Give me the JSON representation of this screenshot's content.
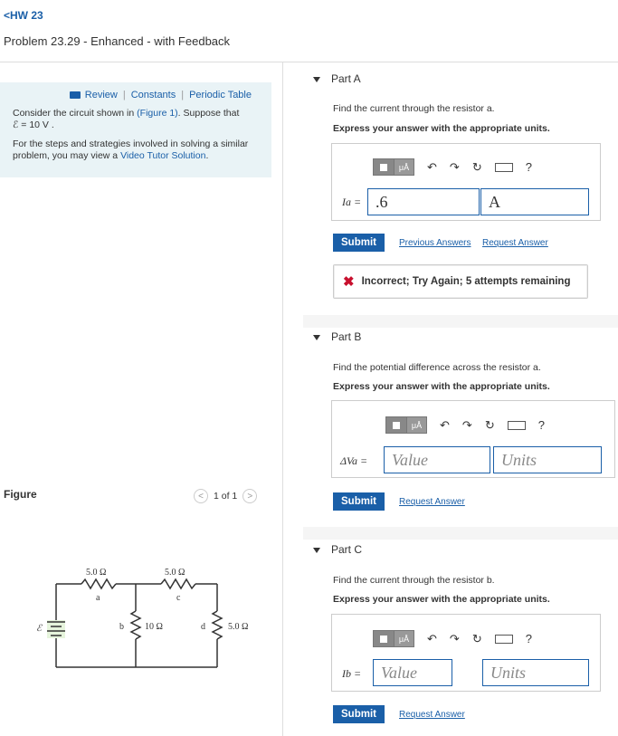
{
  "nav": {
    "back_label": "HW 23"
  },
  "problem": {
    "title": "Problem 23.29 - Enhanced - with Feedback"
  },
  "info": {
    "links": [
      "Review",
      "Constants",
      "Periodic Table"
    ],
    "text1_a": "Consider the circuit shown in ",
    "figure_link": "(Figure 1)",
    "text1_b": ". Suppose that",
    "emf_eq": "ℰ = 10  V .",
    "text2_a": "For the steps and strategies involved in solving a similar problem, you may view a ",
    "video_link": "Video Tutor Solution",
    "text2_b": "."
  },
  "figure": {
    "label": "Figure",
    "pager": "1 of 1"
  },
  "circuit": {
    "emf": "ℰ",
    "r_a": "5.0 Ω",
    "r_c": "5.0 Ω",
    "r_b": "10 Ω",
    "r_d": "5.0 Ω",
    "n_a": "a",
    "n_b": "b",
    "n_c": "c",
    "n_d": "d"
  },
  "partA": {
    "label": "Part A",
    "question": "Find the current through the resistor a.",
    "instruction": "Express your answer with the appropriate units.",
    "var_label": "Ia =",
    "value": ".6",
    "units": "A",
    "submit": "Submit",
    "prev_answers": "Previous Answers",
    "request_answer": "Request Answer",
    "feedback": "Incorrect; Try Again; 5 attempts remaining"
  },
  "partB": {
    "label": "Part B",
    "question": "Find the potential difference across the resistor a.",
    "instruction": "Express your answer with the appropriate units.",
    "var_label": "ΔVa =",
    "value_placeholder": "Value",
    "units_placeholder": "Units",
    "submit": "Submit",
    "request_answer": "Request Answer"
  },
  "partC": {
    "label": "Part C",
    "question": "Find the current through the resistor b.",
    "instruction": "Express your answer with the appropriate units.",
    "var_label": "Ib =",
    "value_placeholder": "Value",
    "units_placeholder": "Units",
    "submit": "Submit",
    "request_answer": "Request Answer"
  },
  "toolbar": {
    "units_glyph": "μÅ",
    "help": "?"
  }
}
